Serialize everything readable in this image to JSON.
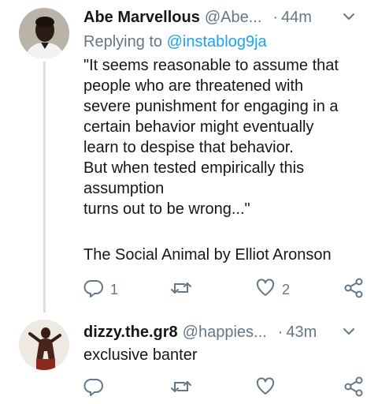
{
  "tweets": [
    {
      "author_name": "Abe Marvellous",
      "handle": "@Abe...",
      "separator": "·",
      "time": "44m",
      "replying_label": "Replying to",
      "replying_handle": "@instablog9ja",
      "body_lines": [
        "\"It seems reasonable to assume that",
        "people who are threatened with",
        "severe punishment for engaging in a",
        "certain behavior might eventually",
        "learn to despise that behavior.",
        "But when tested empirically this",
        "assumption",
        "turns out to be wrong...\"",
        "",
        "The Social Animal by Elliot Aronson"
      ],
      "reply_count": "1",
      "like_count": "2",
      "icons": [
        "reply-icon",
        "retweet-icon",
        "like-icon",
        "share-icon",
        "chevron-down-icon"
      ]
    },
    {
      "author_name": "dizzy.the.gr8",
      "handle": "@happies...",
      "separator": "·",
      "time": "43m",
      "body_lines": [
        "exclusive banter"
      ],
      "icons": [
        "reply-icon",
        "retweet-icon",
        "like-icon",
        "share-icon",
        "chevron-down-icon"
      ]
    }
  ],
  "colors": {
    "text": "#14171a",
    "secondary": "#657786",
    "link": "#1da1f2",
    "thread_line": "#d8dee3"
  }
}
